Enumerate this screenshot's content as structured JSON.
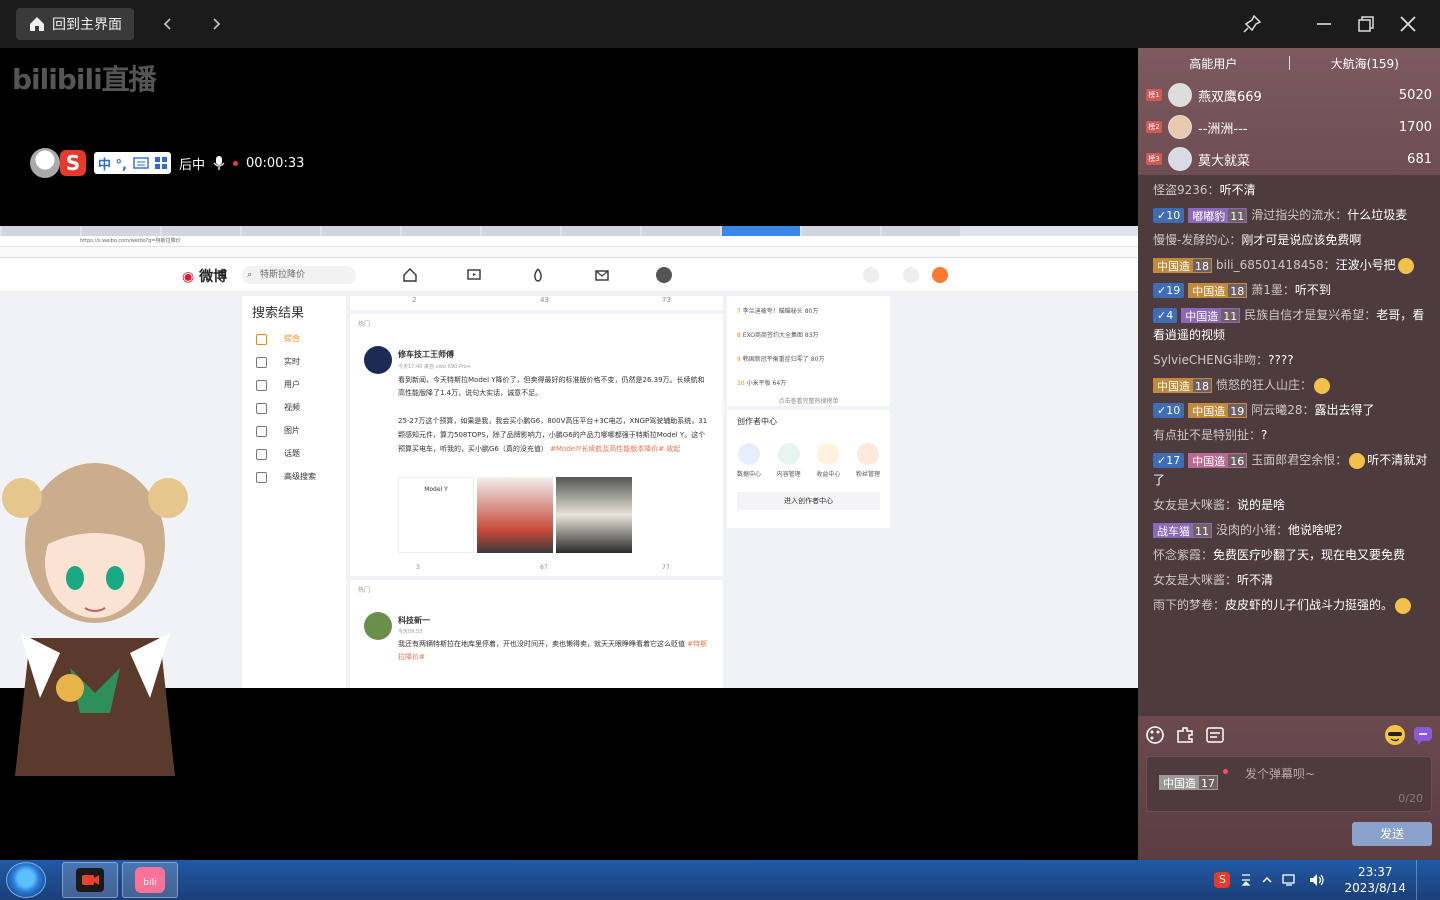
{
  "titlebar": {
    "home_label": "回到主界面"
  },
  "stage": {
    "logo": "bilibili直播",
    "status": {
      "ime_chars": "中 °,",
      "live_text": "后中",
      "timer": "00:00:33"
    }
  },
  "shared_screen": {
    "browser_address": "https://s.weibo.com/weibo?q=特斯拉降价",
    "weibo": {
      "logo": "微博",
      "search": "特斯拉降价",
      "results_title": "搜索结果",
      "nav": [
        "综合",
        "实时",
        "用户",
        "视频",
        "图片",
        "话题",
        "高级搜索"
      ],
      "posts": [
        {
          "tag": "热门",
          "author": "修车技工王师傅",
          "meta": "今天17:40  来自 vivo X90 Pro+",
          "body": "看到新闻，今天特斯拉Model Y降价了，但卖得最好的标准版价格不变，仍然是26.39万。长续航和高性能版降了1.4万，说句大实话，诚意不足。",
          "body2": "25-27万这个预算，如果是我，我会买小鹏G6，800V高压平台+3C电芯，XNGP驾驶辅助系统，31颗感知元件，算力508TOPS，除了品牌影响力，小鹏G6的产品力哪哪都强于特斯拉Model Y。这个预算买电车，听我的，买小鹏G6（真的没充值）",
          "hashtag": "#ModelY长续航及高性能版本降价#",
          "more": "收起",
          "reposts": "3",
          "comments": "67",
          "likes": "77",
          "image_title": "Model Y"
        },
        {
          "tag": "热门",
          "author": "科技新一",
          "meta": "今天09:53",
          "body": "我还有两辆特斯拉在地库里停着，开也没时间开，卖也懒得卖，就天天眼睁睁看着它这么贬值",
          "hashtag": "#特斯拉降价#"
        }
      ],
      "top_counts": {
        "reposts": "2",
        "comments": "43",
        "likes": "73"
      },
      "hot_list": [
        {
          "rank": "7",
          "text": "李兰迪被夸！瞄瞄秘头",
          "count": "80万"
        },
        {
          "rank": "8",
          "text": "EXO商商签约大全集图",
          "count": "83万"
        },
        {
          "rank": "9",
          "text": "韩国新冠平衡重症归零了",
          "count": "80万"
        },
        {
          "rank": "10",
          "text": "小米平板",
          "count": "64万"
        }
      ],
      "hot_more": "点击查看完整热搜榜单",
      "creator_title": "创作者中心",
      "creator_items": [
        "数据中心",
        "内容管理",
        "收益中心",
        "粉丝管理"
      ],
      "creator_enter": "进入创作者中心"
    }
  },
  "sidepanel": {
    "tabs": [
      "高能用户",
      "大航海(159)"
    ],
    "top_users": [
      {
        "rank": "榜1",
        "name": "燕双鹰669",
        "score": "5020"
      },
      {
        "rank": "榜2",
        "name": "--洲洲---",
        "score": "1700"
      },
      {
        "rank": "榜3",
        "name": "莫大就菜",
        "score": "681"
      }
    ],
    "messages": [
      {
        "user": "怪盗9236",
        "text": "听不清"
      },
      {
        "guard": "10",
        "medal": "嘟嘟豹",
        "level": "11",
        "medal_color": "purple",
        "user": "滑过指尖的流水",
        "text": "什么垃圾麦"
      },
      {
        "user": "慢慢-发酵的心",
        "text": "刚才可是说应该免费啊"
      },
      {
        "medal": "中国造",
        "level": "18",
        "medal_color": "gold",
        "user": "bili_68501418458",
        "text": "汪波小号把",
        "emoji": true
      },
      {
        "guard": "19",
        "medal": "中国造",
        "level": "18",
        "medal_color": "gold",
        "user": "萧1墨",
        "text": "听不到"
      },
      {
        "guard": "4",
        "medal": "中国造",
        "level": "11",
        "medal_color": "purple",
        "user": "民族自信才是复兴希望",
        "text": "老哥，看看逍遥的视频"
      },
      {
        "user": "SylvieCHENG非吻",
        "text": "????"
      },
      {
        "medal": "中国造",
        "level": "18",
        "medal_color": "gold",
        "user": "愤怒的狂人山庄",
        "text": "",
        "emoji": true
      },
      {
        "guard": "10",
        "medal": "中国造",
        "level": "19",
        "medal_color": "gold",
        "user": "阿云曦28",
        "text": "露出去得了"
      },
      {
        "user": "有点扯不是特别扯",
        "text": "?"
      },
      {
        "guard": "17",
        "medal": "中国造",
        "level": "16",
        "medal_color": "pink",
        "user": "玉面郎君空余恨",
        "text": "听不清就对了",
        "emoji_before": true
      },
      {
        "user": "女友是大咪酱",
        "text": "说的是啥"
      },
      {
        "medal": "战车猫",
        "level": "11",
        "medal_color": "purple",
        "user": "没肉的小猪",
        "text": "他说啥呢？"
      },
      {
        "user": "怀念紫霞",
        "text": "免费医疗吵翻了天，现在电又要免费"
      },
      {
        "user": "女友是大咪酱",
        "text": "听不清"
      },
      {
        "user": "雨下的梦卷",
        "text": "皮皮虾的儿子们战斗力挺强的。",
        "emoji": true
      }
    ],
    "input": {
      "medal": "中国造",
      "level": "17",
      "placeholder": "发个弹幕呗~",
      "count": "0/20",
      "send": "发送"
    }
  },
  "taskbar": {
    "time": "23:37",
    "date": "2023/8/14"
  }
}
